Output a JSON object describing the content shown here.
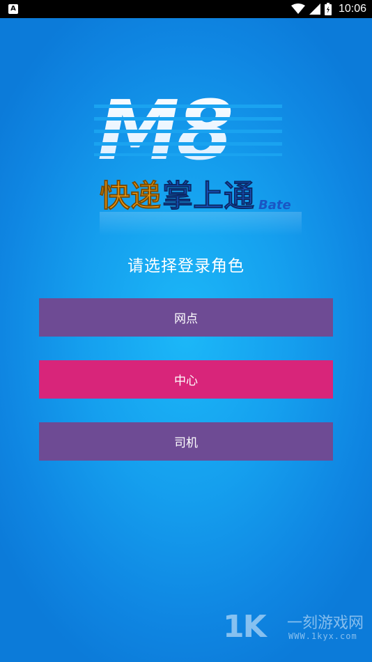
{
  "status_bar": {
    "time": "10:06",
    "left_icon": "A",
    "icons": [
      "wifi-icon",
      "signal-icon",
      "battery-icon"
    ]
  },
  "logo": {
    "mark": "M8",
    "title_orange": "快递",
    "title_blue": "掌上通",
    "badge": "Bate"
  },
  "prompt": "请选择登录角色",
  "roles": [
    {
      "label": "网点",
      "color": "#6e4b94"
    },
    {
      "label": "中心",
      "color": "#d8257a"
    },
    {
      "label": "司机",
      "color": "#6e4b94"
    }
  ],
  "watermark": {
    "brand": "1K",
    "title": "一刻游戏网",
    "url": "WWW.1kyx.com"
  },
  "colors": {
    "background": "#159fee",
    "logo_orange": "#f7a21b",
    "logo_blue": "#1a56c4"
  }
}
